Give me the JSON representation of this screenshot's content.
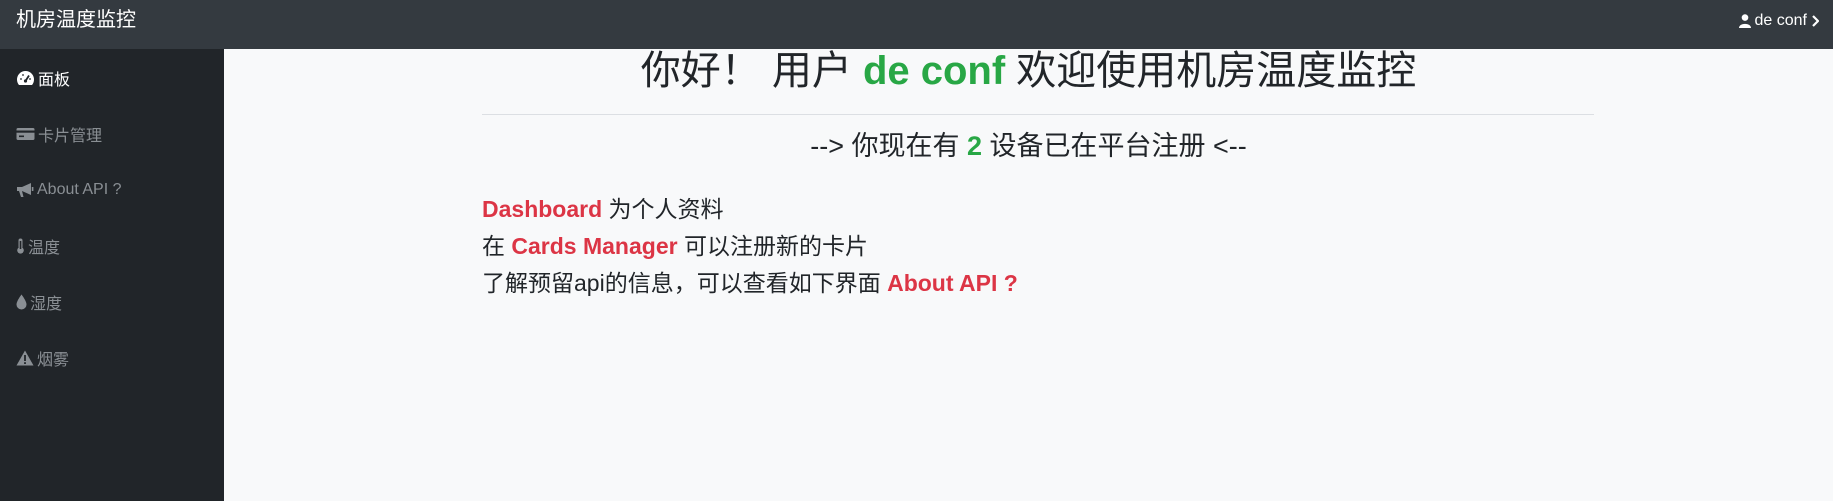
{
  "app": {
    "title": "机房温度监控"
  },
  "user_menu": {
    "username": "de conf"
  },
  "sidebar": {
    "items": [
      {
        "label": "面板",
        "icon": "dashboard-gauge-icon",
        "active": true
      },
      {
        "label": "卡片管理",
        "icon": "credit-card-icon",
        "active": false
      },
      {
        "label": "About API ?",
        "icon": "megaphone-icon",
        "active": false
      },
      {
        "label": "温度",
        "icon": "thermometer-icon",
        "active": false
      },
      {
        "label": "湿度",
        "icon": "water-drop-icon",
        "active": false
      },
      {
        "label": "烟雾",
        "icon": "warning-triangle-icon",
        "active": false
      }
    ]
  },
  "main": {
    "greeting": {
      "prefix": "你好！ 用户 ",
      "username": "de conf",
      "suffix": " 欢迎使用机房温度监控"
    },
    "device_status": {
      "prefix": "--> 你现在有 ",
      "count": "2",
      "suffix": " 设备已在平台注册 <--"
    },
    "lines": [
      {
        "before": "",
        "link": "Dashboard",
        "after": " 为个人资料"
      },
      {
        "before": "在 ",
        "link": "Cards Manager",
        "after": " 可以注册新的卡片"
      },
      {
        "before": "了解预留api的信息，可以查看如下界面 ",
        "link": "About API ?",
        "after": ""
      }
    ]
  },
  "colors": {
    "topbar": "#343a40",
    "sidebar": "#212529",
    "main_bg": "#f8f9fa",
    "accent_green": "#28a745",
    "accent_red": "#dc3545",
    "muted_nav": "#8a8f94"
  }
}
